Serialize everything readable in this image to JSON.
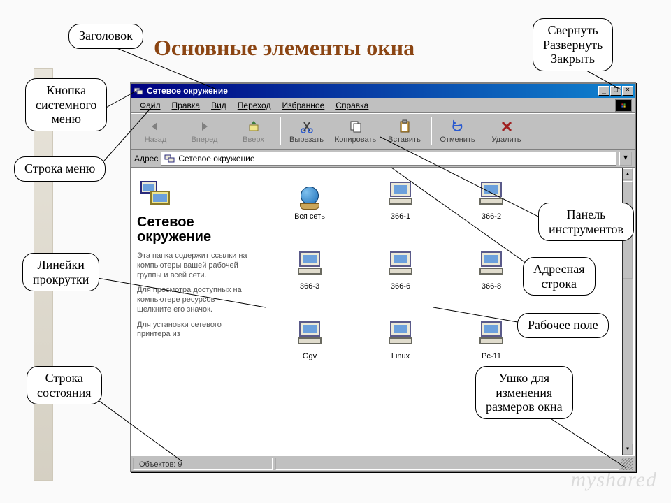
{
  "page": {
    "title": "Основные элементы окна"
  },
  "callouts": {
    "title_label": "Заголовок",
    "sysmenu": "Кнопка\nсистемного\nменю",
    "menubar": "Строка меню",
    "scrollbars": "Линейки\nпрокрутки",
    "statusbar": "Строка\nсостояния",
    "winbuttons": "Свернуть\nРазвернуть\nЗакрыть",
    "toolbar": "Панель\nинструментов",
    "addressbar": "Адресная\nстрока",
    "workarea": "Рабочее поле",
    "grip": "Ушко для\nизменения\nразмеров окна"
  },
  "window": {
    "title": "Сетевое окружение",
    "menus": [
      "Файл",
      "Правка",
      "Вид",
      "Переход",
      "Избранное",
      "Справка"
    ],
    "toolbar": [
      {
        "label": "Назад",
        "icon": "back",
        "disabled": true
      },
      {
        "label": "Вперед",
        "icon": "forward",
        "disabled": true
      },
      {
        "label": "Вверх",
        "icon": "up",
        "disabled": true
      },
      {
        "sep": true
      },
      {
        "label": "Вырезать",
        "icon": "cut"
      },
      {
        "label": "Копировать",
        "icon": "copy"
      },
      {
        "label": "Вставить",
        "icon": "paste"
      },
      {
        "sep": true
      },
      {
        "label": "Отменить",
        "icon": "undo"
      },
      {
        "label": "Удалить",
        "icon": "delete"
      }
    ],
    "address_label": "Адрес",
    "address_value": "Сетевое окружение",
    "info": {
      "heading": "Сетевое окружение",
      "p1": "Эта папка содержит ссылки на компьютеры вашей рабочей группы и всей сети.",
      "p2": "Для просмотра доступных на компьютере ресурсов щелкните его значок.",
      "p3": "Для установки сетевого принтера из"
    },
    "items": [
      {
        "label": "Вся сеть",
        "icon": "globe"
      },
      {
        "label": "366-1",
        "icon": "pc"
      },
      {
        "label": "366-2",
        "icon": "pc"
      },
      {
        "label": "366-3",
        "icon": "pc"
      },
      {
        "label": "366-6",
        "icon": "pc"
      },
      {
        "label": "366-8",
        "icon": "pc"
      },
      {
        "label": "Ggv",
        "icon": "pc"
      },
      {
        "label": "Linux",
        "icon": "pc"
      },
      {
        "label": "Pc-11",
        "icon": "pc"
      }
    ],
    "status": "Объектов: 9"
  },
  "watermark": "myshared"
}
